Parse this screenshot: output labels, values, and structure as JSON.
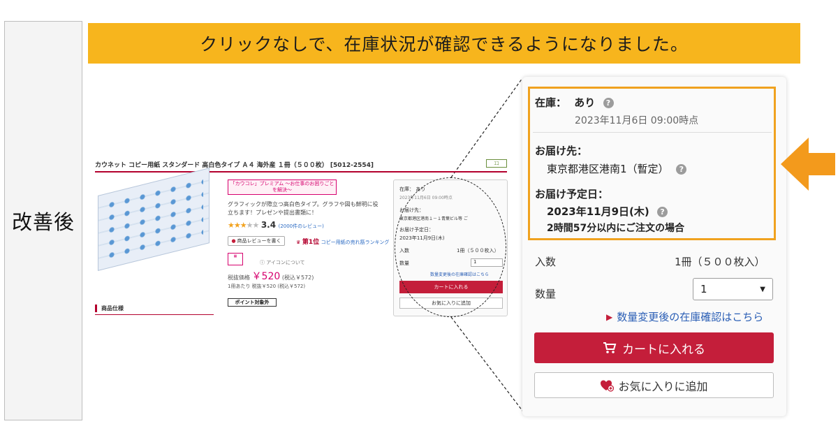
{
  "side_label": "改善後",
  "banner": "クリックなしで、在庫状況が確認できるようになりました。",
  "colors": {
    "banner": "#f7b51d",
    "highlight_border": "#f0a21f",
    "arrow": "#f39a1c",
    "cart_button": "#c41e3a",
    "link": "#2a5eb5",
    "brand_red": "#b3002d"
  },
  "product_page": {
    "title": "カウネット コピー用紙 スタンダード 高白色タイプ Ａ４ 海外産 １冊（５００枚） [5012-2554]",
    "eco_badge": "ｴｺ",
    "tag": "「カウコレ」プレミアム ～お仕事のお困りごとを解決～",
    "description": "グラフィックが際立つ高白色タイプ。グラフや図も鮮明に役立ちます！プレゼンや提出書類に！",
    "rating_score": "3.4",
    "rating_reviews": "(2000件のレビュー)",
    "review_button": "商品レビューを書く",
    "rank_label": "第1位",
    "rank_link": "コピー用紙の売れ筋ランキング",
    "icon_note": "アイコンについて",
    "price_label": "税抜価格",
    "price": "￥520",
    "price_tax": "(税込￥572)",
    "unit_price": "1冊あたり 税抜￥520 (税込￥572)",
    "point_badge": "ポイント対象外",
    "spec_heading": "商品仕様"
  },
  "mini_cart": {
    "stock": "在庫： あり",
    "stock_time": "2023年11月6日 09:00時点",
    "dest_label": "お届け先：",
    "dest_value": "東京都港区港南１－１青葉ビル等 ご",
    "date_label": "お届け予定日：",
    "date_value": "2023年11月9日(木)",
    "qty_label": "入数",
    "qty_value": "1冊（５００枚入）",
    "count_label": "数量",
    "count_value": "1",
    "link": "数量変更後の在庫確認はこちら",
    "cart": "カートに入れる",
    "fav": "お気に入りに追加"
  },
  "cart_panel": {
    "stock_label": "在庫：",
    "stock_value": "あり",
    "stock_time": "2023年11月6日 09:00時点",
    "dest_label": "お届け先：",
    "dest_value": "東京都港区港南1（暫定）",
    "date_label": "お届け予定日：",
    "date_value": "2023年11月9日(木)",
    "deadline": "2時間57分以内にご注文の場合",
    "qty_label": "入数",
    "qty_value": "1冊（５００枚入）",
    "count_label": "数量",
    "count_value": "1",
    "stock_link": "数量変更後の在庫確認はこちら",
    "cart_button": "カートに入れる",
    "fav_button": "お気に入りに追加"
  }
}
